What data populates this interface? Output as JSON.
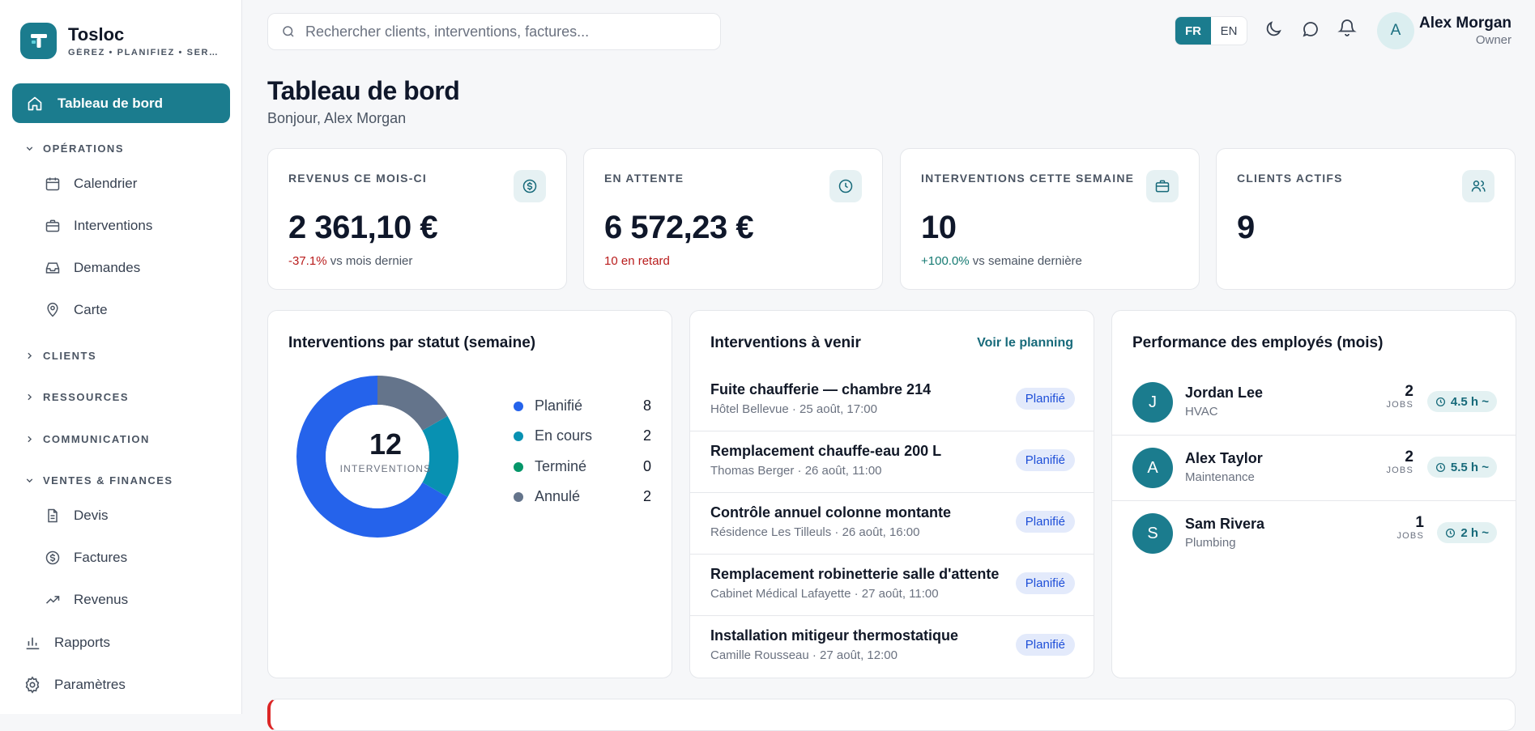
{
  "brand": {
    "name": "Tosloc",
    "tagline": "GÉREZ • PLANIFIEZ • SERVICES"
  },
  "nav": {
    "active": "Tableau de bord",
    "sections": {
      "operations": "OPÉRATIONS",
      "clients": "CLIENTS",
      "ressources": "RESSOURCES",
      "communication": "COMMUNICATION",
      "ventes": "VENTES & FINANCES"
    },
    "items": {
      "calendrier": "Calendrier",
      "interventions": "Interventions",
      "demandes": "Demandes",
      "carte": "Carte",
      "devis": "Devis",
      "factures": "Factures",
      "revenus": "Revenus",
      "rapports": "Rapports",
      "parametres": "Paramètres"
    }
  },
  "search": {
    "placeholder": "Rechercher clients, interventions, factures..."
  },
  "lang": {
    "fr": "FR",
    "en": "EN"
  },
  "user": {
    "initial": "A",
    "name": "Alex Morgan",
    "role": "Owner"
  },
  "page": {
    "title": "Tableau de bord",
    "greeting": "Bonjour, Alex Morgan"
  },
  "stats": [
    {
      "label": "REVENUS CE MOIS-CI",
      "value": "2 361,10 €",
      "delta": "-37.1%",
      "note": " vs mois dernier",
      "icon": "dollar-icon"
    },
    {
      "label": "EN ATTENTE",
      "value": "6 572,23 €",
      "note": "10 en retard",
      "icon": "clock-icon"
    },
    {
      "label": "INTERVENTIONS CETTE SEMAINE",
      "value": "10",
      "delta": "+100.0%",
      "note": " vs semaine dernière",
      "icon": "briefcase-icon"
    },
    {
      "label": "CLIENTS ACTIFS",
      "value": "9",
      "icon": "users-icon"
    }
  ],
  "status_panel": {
    "title": "Interventions par statut (semaine)",
    "total": "12",
    "total_label": "INTERVENTIONS",
    "legend": [
      {
        "label": "Planifié",
        "count": "8",
        "color": "#2563eb"
      },
      {
        "label": "En cours",
        "count": "2",
        "color": "#0891b2"
      },
      {
        "label": "Terminé",
        "count": "0",
        "color": "#059669"
      },
      {
        "label": "Annulé",
        "count": "2",
        "color": "#64748b"
      }
    ]
  },
  "chart_data": {
    "type": "pie",
    "categories": [
      "Planifié",
      "En cours",
      "Terminé",
      "Annulé"
    ],
    "values": [
      8,
      2,
      0,
      2
    ],
    "colors": [
      "#2563eb",
      "#0891b2",
      "#059669",
      "#64748b"
    ],
    "title": "Interventions par statut (semaine)",
    "center_value": "12",
    "center_label": "INTERVENTIONS"
  },
  "upcoming": {
    "title": "Interventions à venir",
    "link": "Voir le planning",
    "items": [
      {
        "title": "Fuite chaufferie — chambre 214",
        "meta": "Hôtel Bellevue · 25 août, 17:00",
        "status": "Planifié"
      },
      {
        "title": "Remplacement chauffe-eau 200 L",
        "meta": "Thomas Berger · 26 août, 11:00",
        "status": "Planifié"
      },
      {
        "title": "Contrôle annuel colonne montante",
        "meta": "Résidence Les Tilleuls · 26 août, 16:00",
        "status": "Planifié"
      },
      {
        "title": "Remplacement robinetterie salle d'attente",
        "meta": "Cabinet Médical Lafayette · 27 août, 11:00",
        "status": "Planifié"
      },
      {
        "title": "Installation mitigeur thermostatique",
        "meta": "Camille Rousseau · 27 août, 12:00",
        "status": "Planifié"
      }
    ]
  },
  "employees": {
    "title": "Performance des employés (mois)",
    "jobs_label": "JOBS",
    "items": [
      {
        "initial": "J",
        "name": "Jordan Lee",
        "role": "HVAC",
        "jobs": "2",
        "hours": "4.5 h ~"
      },
      {
        "initial": "A",
        "name": "Alex Taylor",
        "role": "Maintenance",
        "jobs": "2",
        "hours": "5.5 h ~"
      },
      {
        "initial": "S",
        "name": "Sam Rivera",
        "role": "Plumbing",
        "jobs": "1",
        "hours": "2 h ~"
      }
    ]
  }
}
